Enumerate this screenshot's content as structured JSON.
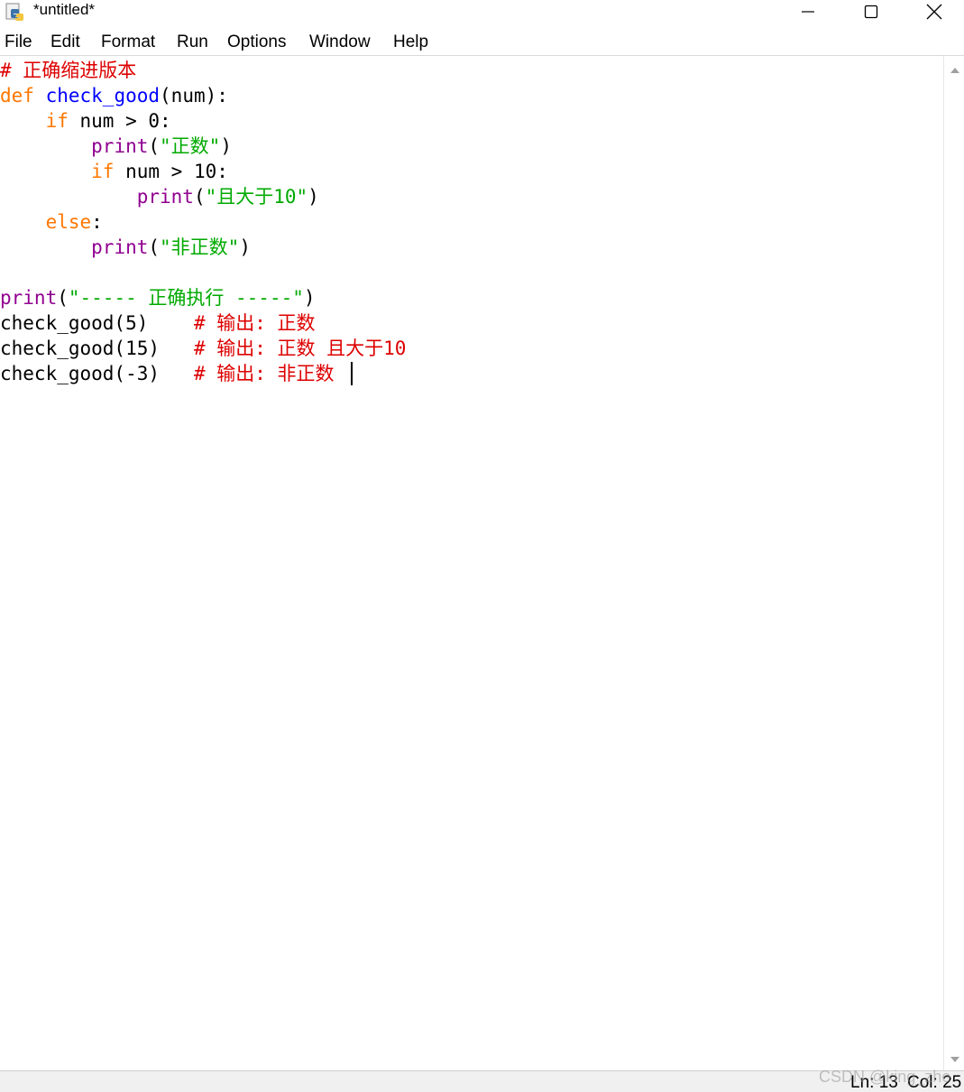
{
  "window": {
    "title": "*untitled*"
  },
  "menu": {
    "items": [
      "File",
      "Edit",
      "Format",
      "Run",
      "Options",
      "Window",
      "Help"
    ]
  },
  "editor": {
    "lines": [
      [
        {
          "t": "# 正确缩进版本",
          "c": "cmt"
        }
      ],
      [
        {
          "t": "def",
          "c": "kw"
        },
        {
          "t": " ",
          "c": ""
        },
        {
          "t": "check_good",
          "c": "def"
        },
        {
          "t": "(num):",
          "c": ""
        }
      ],
      [
        {
          "t": "    ",
          "c": ""
        },
        {
          "t": "if",
          "c": "kw"
        },
        {
          "t": " num > 0:",
          "c": ""
        }
      ],
      [
        {
          "t": "        ",
          "c": ""
        },
        {
          "t": "print",
          "c": "bi"
        },
        {
          "t": "(",
          "c": ""
        },
        {
          "t": "\"正数\"",
          "c": "str"
        },
        {
          "t": ")",
          "c": ""
        }
      ],
      [
        {
          "t": "        ",
          "c": ""
        },
        {
          "t": "if",
          "c": "kw"
        },
        {
          "t": " num > 10:",
          "c": ""
        }
      ],
      [
        {
          "t": "            ",
          "c": ""
        },
        {
          "t": "print",
          "c": "bi"
        },
        {
          "t": "(",
          "c": ""
        },
        {
          "t": "\"且大于10\"",
          "c": "str"
        },
        {
          "t": ")",
          "c": ""
        }
      ],
      [
        {
          "t": "    ",
          "c": ""
        },
        {
          "t": "else",
          "c": "kw"
        },
        {
          "t": ":",
          "c": ""
        }
      ],
      [
        {
          "t": "        ",
          "c": ""
        },
        {
          "t": "print",
          "c": "bi"
        },
        {
          "t": "(",
          "c": ""
        },
        {
          "t": "\"非正数\"",
          "c": "str"
        },
        {
          "t": ")",
          "c": ""
        }
      ],
      [],
      [
        {
          "t": "print",
          "c": "bi"
        },
        {
          "t": "(",
          "c": ""
        },
        {
          "t": "\"----- 正确执行 -----\"",
          "c": "str"
        },
        {
          "t": ")",
          "c": ""
        }
      ],
      [
        {
          "t": "check_good(5)    ",
          "c": ""
        },
        {
          "t": "# 输出: 正数",
          "c": "cmt"
        }
      ],
      [
        {
          "t": "check_good(15)   ",
          "c": ""
        },
        {
          "t": "# 输出: 正数 且大于10",
          "c": "cmt"
        }
      ],
      [
        {
          "t": "check_good(-3)   ",
          "c": ""
        },
        {
          "t": "# 输出: 非正数",
          "c": "cmt"
        }
      ]
    ]
  },
  "status": {
    "line": "Ln: 13",
    "col": "Col: 25"
  },
  "watermark": "CSDN @king_zhe",
  "colors": {
    "keyword": "#ff7700",
    "definition": "#0000ff",
    "builtin": "#900090",
    "string": "#00aa00",
    "comment": "#dd0000"
  },
  "icons": {
    "app": "python-idle-icon",
    "minimize": "minimize-icon",
    "maximize": "maximize-icon",
    "close": "close-icon"
  }
}
